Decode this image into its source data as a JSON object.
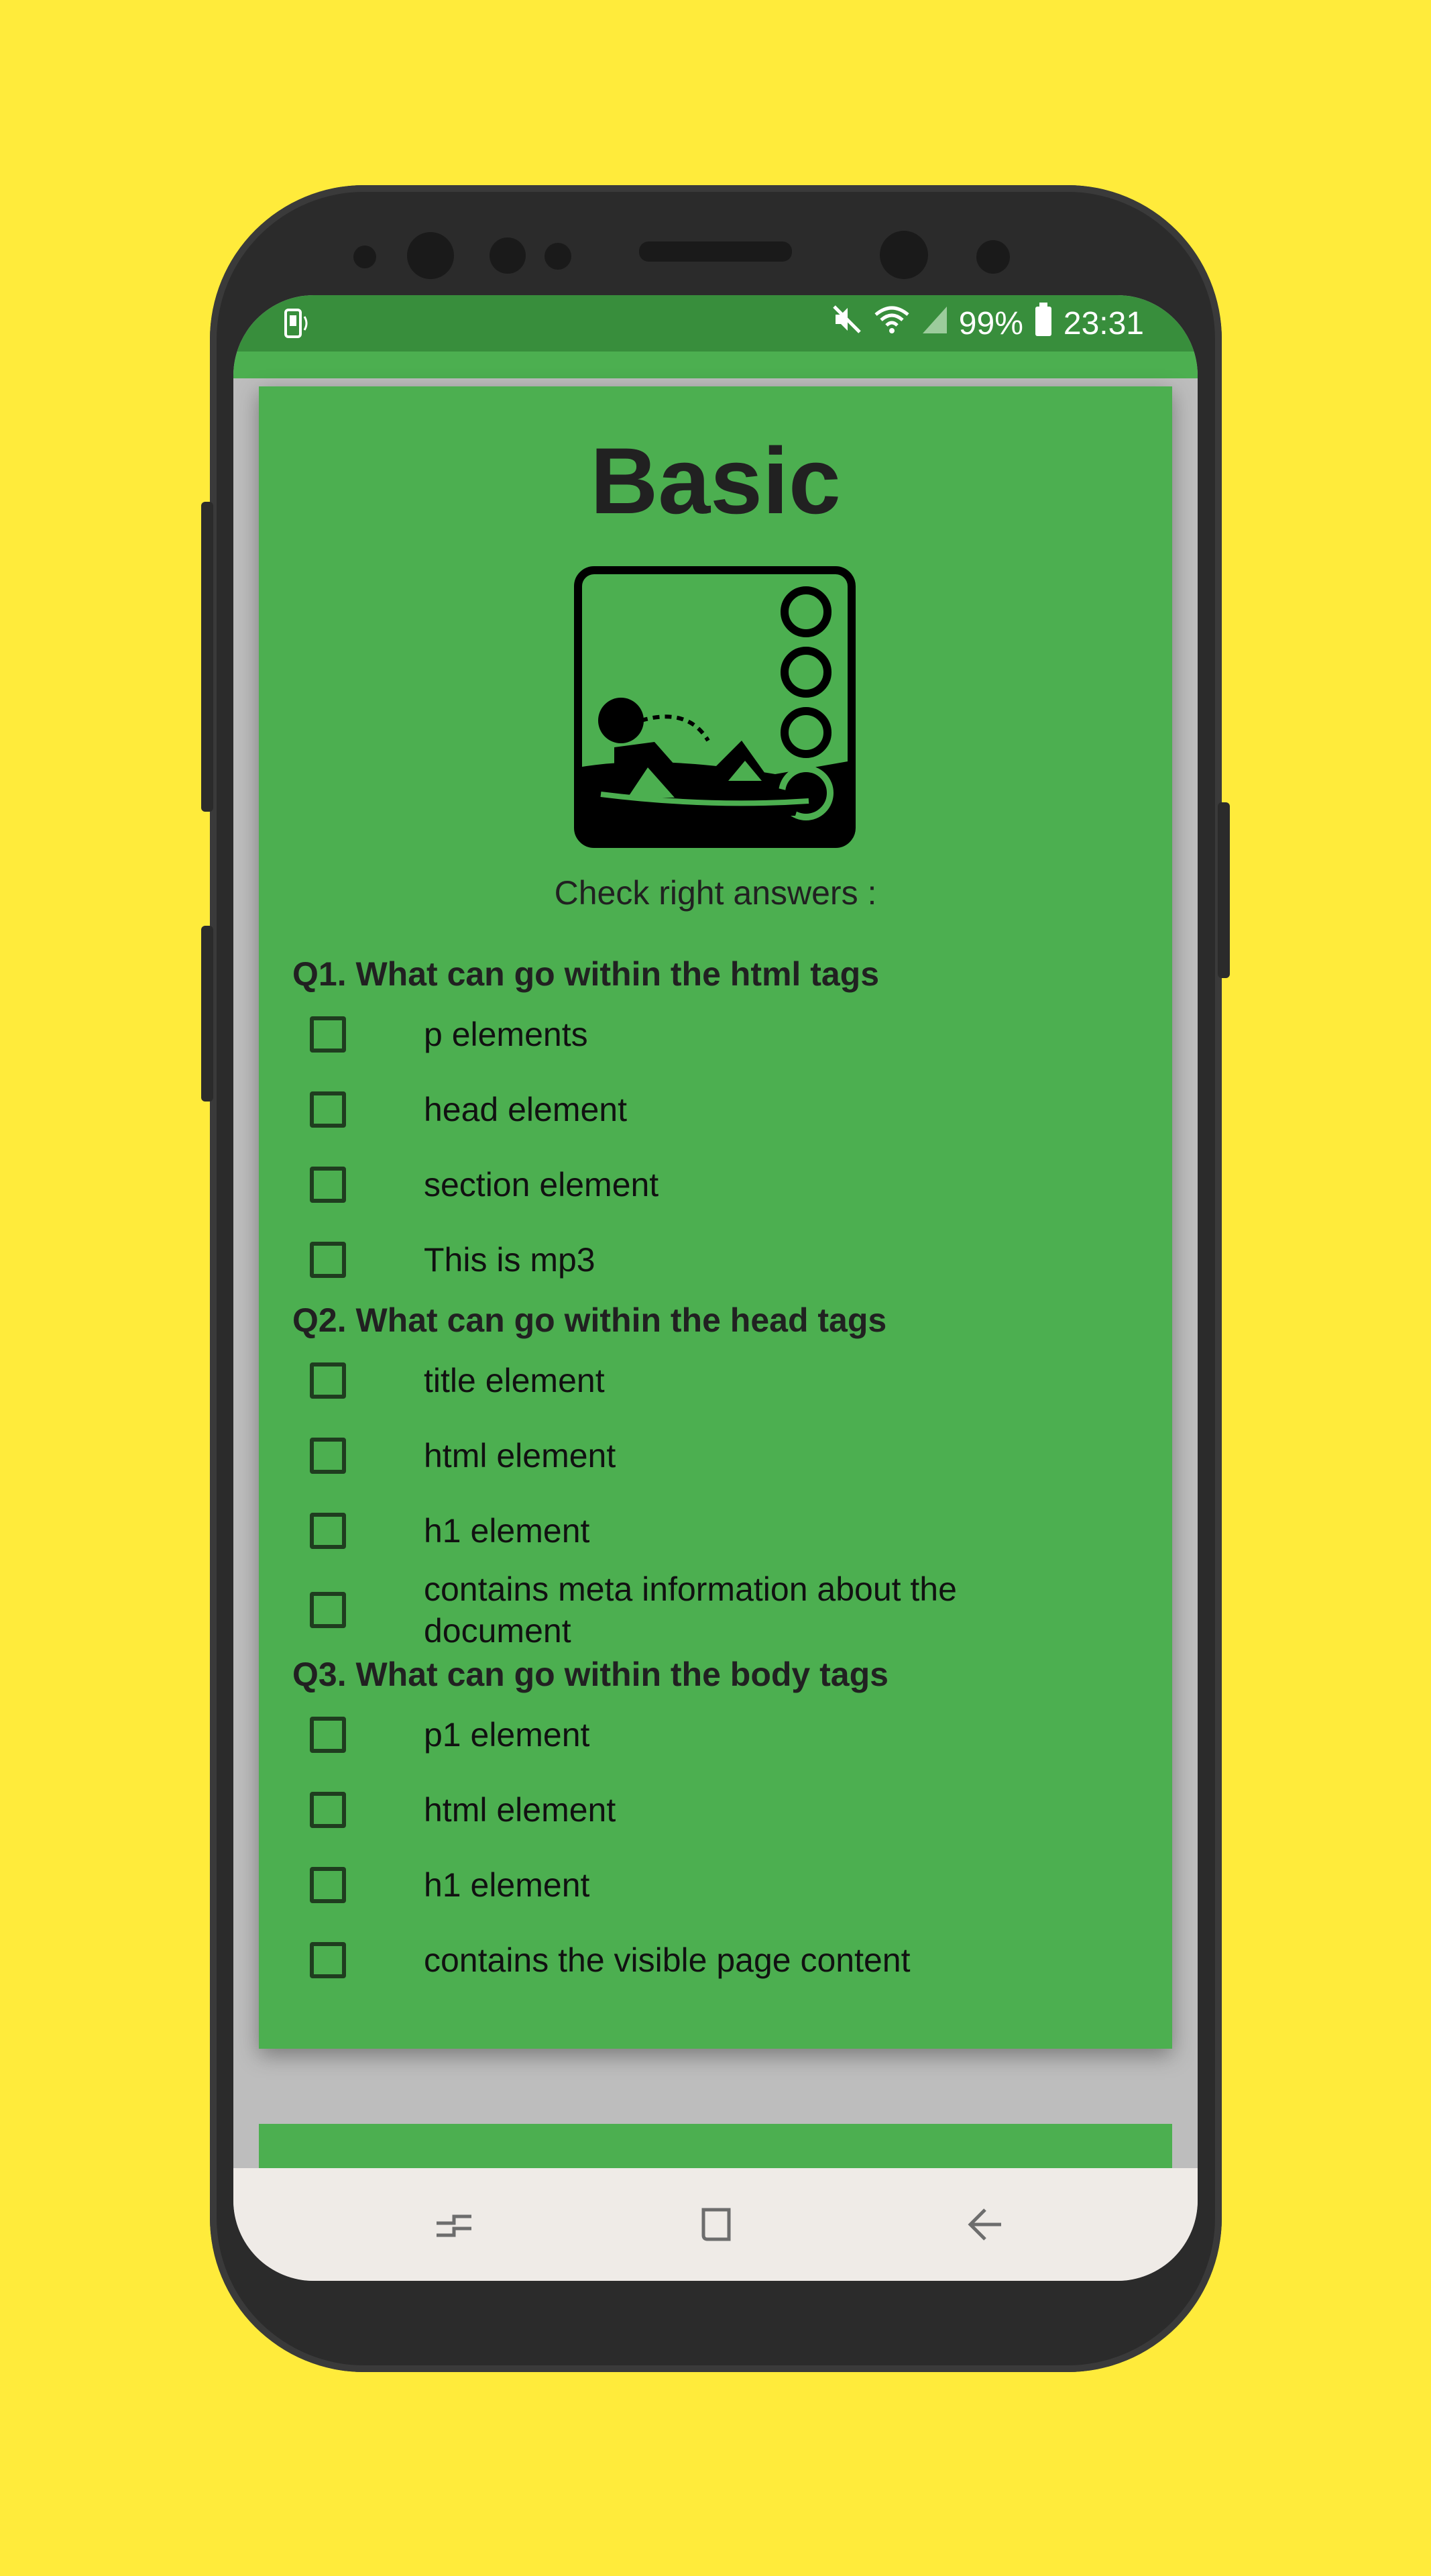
{
  "status_bar": {
    "battery": "99%",
    "time": "23:31",
    "left_icon": "phone-vibrate-icon",
    "right_icons": [
      "mute-icon",
      "wifi-icon",
      "signal-icon",
      "battery-icon"
    ]
  },
  "card": {
    "title": "Basic",
    "illustration_icon": "reclining-abacus-figure-icon",
    "instruction": "Check right answers :"
  },
  "questions": [
    {
      "text": "Q1. What can go within the html tags",
      "options": [
        {
          "label": "p elements",
          "checked": false
        },
        {
          "label": "head element",
          "checked": false
        },
        {
          "label": "section element",
          "checked": false
        },
        {
          "label": "This is mp3",
          "checked": false
        }
      ]
    },
    {
      "text": "Q2. What can go within the head tags",
      "options": [
        {
          "label": "title element",
          "checked": false
        },
        {
          "label": "html element",
          "checked": false
        },
        {
          "label": "h1 element",
          "checked": false
        },
        {
          "label": "contains meta information about the document",
          "checked": false
        }
      ]
    },
    {
      "text": "Q3. What can go within the body tags",
      "options": [
        {
          "label": "p1 element",
          "checked": false
        },
        {
          "label": "html element",
          "checked": false
        },
        {
          "label": "h1 element",
          "checked": false
        },
        {
          "label": "contains the visible page content",
          "checked": false
        }
      ]
    }
  ],
  "nav_bar": {
    "buttons": [
      "recents-icon",
      "home-icon",
      "back-icon"
    ]
  },
  "colors": {
    "background": "#FFEB3B",
    "status_bar": "#388E3C",
    "card": "#4CAF50",
    "nav_bar": "#EFEBE7"
  }
}
